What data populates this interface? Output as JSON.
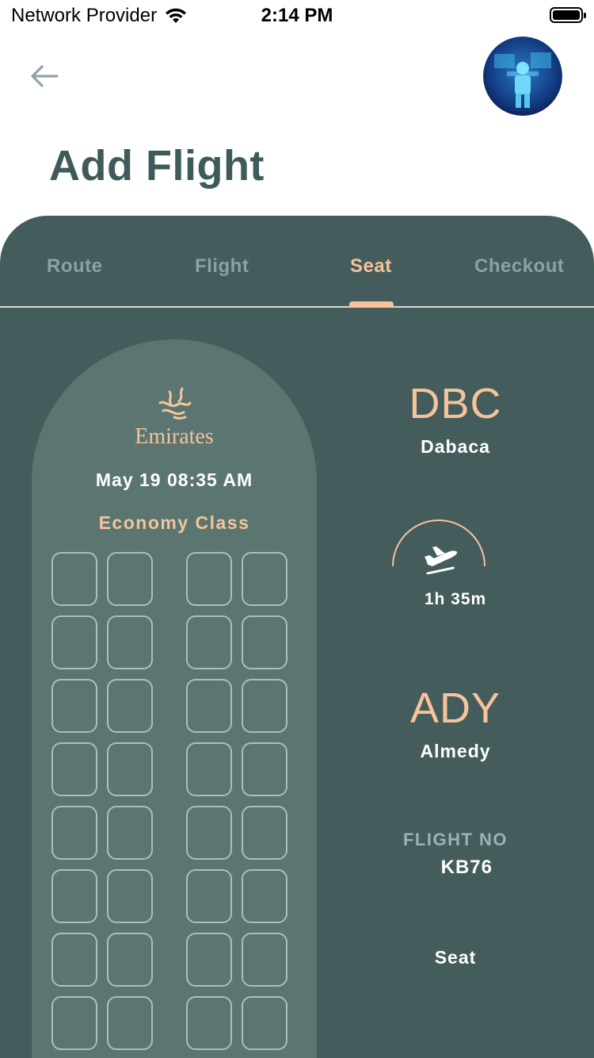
{
  "status_bar": {
    "carrier": "Network Provider",
    "time": "2:14 PM"
  },
  "header": {
    "title": "Add Flight"
  },
  "tabs": [
    {
      "label": "Route",
      "active": false
    },
    {
      "label": "Flight",
      "active": false
    },
    {
      "label": "Seat",
      "active": true
    },
    {
      "label": "Checkout",
      "active": false
    }
  ],
  "flight_card": {
    "airline": "Emirates",
    "date_time": "May 19 08:35 AM",
    "class": "Economy Class",
    "seat_rows_visible": 8,
    "seats_per_row": 4
  },
  "route": {
    "origin_code": "DBC",
    "origin_city": "Dabaca",
    "duration": "1h 35m",
    "destination_code": "ADY",
    "destination_city": "Almedy"
  },
  "flight_no": {
    "label": "FLIGHT NO",
    "value": "KB76"
  },
  "seat": {
    "label": "Seat"
  },
  "colors": {
    "panel": "#445c5c",
    "plane": "#5b7571",
    "accent": "#f5c49a",
    "title": "#3e5a5b"
  }
}
